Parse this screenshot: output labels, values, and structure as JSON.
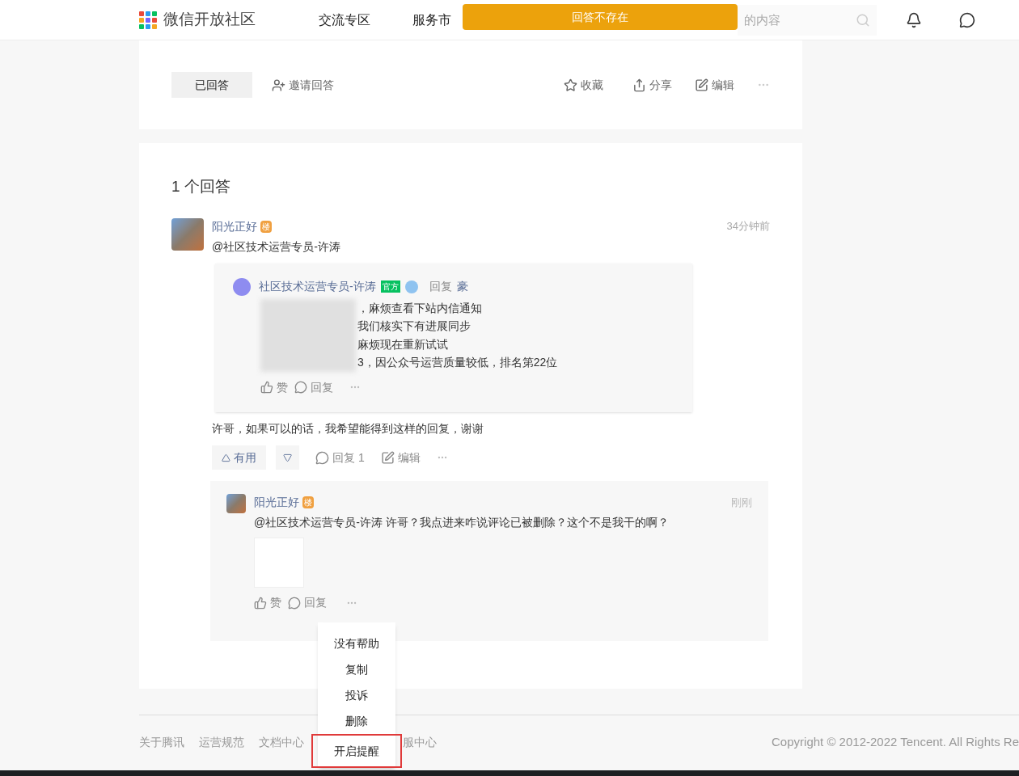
{
  "header": {
    "logo": "微信开放社区",
    "nav": [
      {
        "label": "交流专区",
        "selected": false
      },
      {
        "label": "服务市",
        "selected": false
      }
    ],
    "search": {
      "placeholder": "的内容"
    }
  },
  "toast": "回答不存在",
  "question_actions": {
    "answered": "已回答",
    "invite": "邀请回答",
    "favorite": "收藏",
    "share": "分享",
    "edit": "编辑"
  },
  "answers": {
    "count": "1 个回答",
    "answer": {
      "author": "阳光正好",
      "badge": "楼",
      "time": "34分钟前",
      "mention": "@社区技术运营专员-许涛",
      "quote": {
        "author": "社区技术运营专员-许涛",
        "official": "官方",
        "reply": "回复",
        "reply_to": "豪",
        "lines": [
          "，麻烦查看下站内信通知",
          "我们核实下有进展同步",
          "麻烦现在重新试试",
          "3，因公众号运营质量较低，排名第22位"
        ],
        "like": "赞",
        "reply_action": "回复"
      },
      "text": "许哥，如果可以的话，我希望能得到这样的回复，谢谢",
      "useful": "有用",
      "reply_count": "回复 1",
      "edit": "编辑",
      "comment": {
        "author": "阳光正好",
        "badge": "楼",
        "time": "刚刚",
        "text": "@社区技术运营专员-许涛 许哥？我点进来咋说评论已被删除？这个不是我干的啊？",
        "like": "赞",
        "reply": "回复"
      }
    }
  },
  "menu": [
    {
      "label": "没有帮助",
      "highlighted": false
    },
    {
      "label": "复制",
      "highlighted": false
    },
    {
      "label": "投诉",
      "highlighted": false
    },
    {
      "label": "删除",
      "highlighted": false
    },
    {
      "label": "开启提醒",
      "highlighted": true
    }
  ],
  "footer": {
    "links": [
      "关于腾讯",
      "运营规范",
      "文档中心",
      "服中心"
    ],
    "copyright": "Copyright © 2012-2022 Tencent. All Rights Re"
  }
}
